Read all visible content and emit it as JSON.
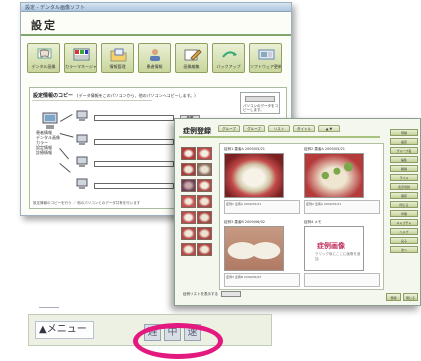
{
  "settings_window": {
    "title_bar": "設定 - デンタル画像ソフト",
    "page_title": "設定",
    "toolbar": [
      {
        "label": "デンタル画像",
        "icon": "tooth-icon"
      },
      {
        "label": "カラーマネージャー",
        "icon": "color-grid-icon"
      },
      {
        "label": "情報管理",
        "icon": "folder-icon"
      },
      {
        "label": "患者情報",
        "icon": "patient-icon"
      },
      {
        "label": "画像編集",
        "icon": "edit-icon"
      },
      {
        "label": "バックアップ",
        "icon": "backup-icon"
      },
      {
        "label": "ソフトウェア更新",
        "icon": "update-icon"
      }
    ],
    "copy_panel": {
      "heading": "設定情報のコピー",
      "subheading": "(データ情報をこのパソコンから、他のパソコンへコピーします。)",
      "side_button": "情報読み込み",
      "side_text": "パソコンのデータをコピーします。",
      "source_list": [
        "患者情報",
        "デンタル画像",
        "カラー",
        "設定情報",
        "診療情報"
      ],
      "pick_label": "参照",
      "footer": "設定情報のコピーを行う ／ 他のパソコンとのデータ共有を行います"
    }
  },
  "case_window": {
    "title": "症例登録",
    "tabs": [
      "グループ",
      "グループ",
      "リスト",
      "タイトル",
      "▲ ▼"
    ],
    "right_bar": [
      "登録",
      "設定",
      "グループ名",
      "編集",
      "削除",
      "ラベル",
      "表示切替",
      "保存",
      "閉じる",
      "印刷",
      "キャプチャ",
      "ヘルプ",
      "戻る",
      "次へ"
    ],
    "cases": [
      {
        "caption": "症例1 患者A 2009/05/21"
      },
      {
        "caption": "症例2 患者A 2009/05/21"
      },
      {
        "caption": "症例3 患者B 2009/06/02"
      },
      {
        "caption": "症例4 メモ"
      }
    ],
    "placeholder_title": "症例画像",
    "placeholder_sub": "クリック後にここに画像を追加",
    "footer_label": "症例リストを表示する",
    "footer_buttons": [
      "登録",
      "閉じる"
    ]
  },
  "bottom_bar": {
    "menu_label": "▲メニュー",
    "speed": [
      "遅",
      "中",
      "速"
    ]
  },
  "colors": {
    "accent_ring": "#e3197f",
    "toolbar_green": "#c9d69c"
  }
}
